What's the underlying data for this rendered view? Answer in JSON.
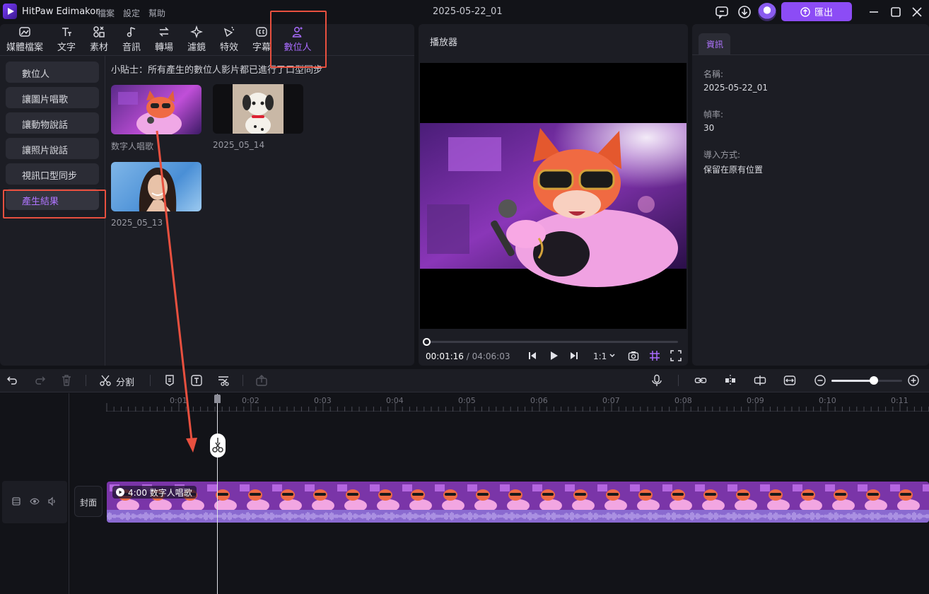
{
  "app": {
    "name": "HitPaw Edimakor",
    "menu": [
      "檔案",
      "設定",
      "幫助"
    ],
    "project_title": "2025-05-22_01",
    "export_label": "匯出",
    "accent": "#8c4cf5"
  },
  "media_tabs": [
    {
      "label": "媒體檔案",
      "icon": "media-icon"
    },
    {
      "label": "文字",
      "icon": "text-icon"
    },
    {
      "label": "素材",
      "icon": "elements-icon"
    },
    {
      "label": "音訊",
      "icon": "music-icon"
    },
    {
      "label": "轉場",
      "icon": "transition-icon"
    },
    {
      "label": "濾鏡",
      "icon": "filter-icon"
    },
    {
      "label": "特效",
      "icon": "effects-icon"
    },
    {
      "label": "字幕",
      "icon": "subtitle-icon"
    },
    {
      "label": "數位人",
      "icon": "avatar-person-icon"
    }
  ],
  "sidebar": [
    {
      "label": "數位人"
    },
    {
      "label": "讓圖片唱歌"
    },
    {
      "label": "讓動物說話"
    },
    {
      "label": "讓照片說話"
    },
    {
      "label": "視訊口型同步"
    },
    {
      "label": "產生結果"
    }
  ],
  "tip": "小貼士：所有產生的數位人影片都已進行了口型同步",
  "results": [
    {
      "label": "数字人唱歌"
    },
    {
      "label": "2025_05_14"
    },
    {
      "label": "2025_05_13"
    }
  ],
  "player": {
    "title": "播放器",
    "current_time": "00:01:16",
    "separator": " / ",
    "total_time": "04:06:03",
    "ratio": "1:1"
  },
  "info": {
    "tab": "資訊",
    "name_label": "名稱:",
    "name_value": "2025-05-22_01",
    "fps_label": "幀率:",
    "fps_value": "30",
    "import_label": "導入方式:",
    "import_value": "保留在原有位置"
  },
  "timeline": {
    "split_label": "分割",
    "ticks": [
      "0:01",
      "0:02",
      "0:03",
      "0:04",
      "0:05",
      "0:06",
      "0:07",
      "0:08",
      "0:09",
      "0:10",
      "0:11"
    ],
    "cover_label": "封面",
    "clip_label": "4:00 数字人唱歌",
    "zoom_level": 0.6
  }
}
